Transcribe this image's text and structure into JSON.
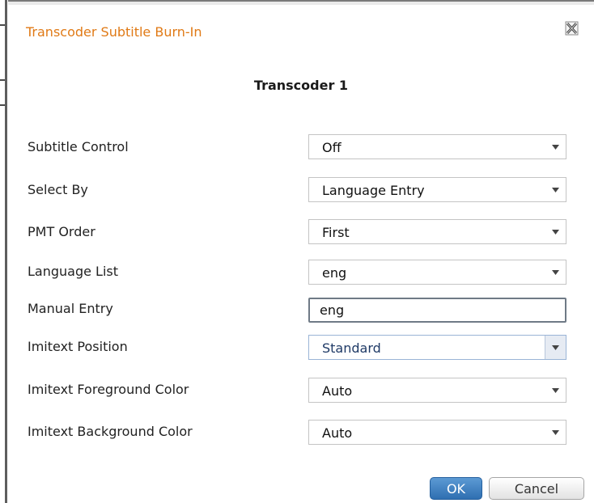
{
  "dialog": {
    "title": "Transcoder Subtitle Burn-In",
    "subheading": "Transcoder 1",
    "close_icon": "close-icon"
  },
  "fields": {
    "subtitle_control": {
      "label": "Subtitle Control",
      "value": "Off"
    },
    "select_by": {
      "label": "Select By",
      "value": "Language Entry"
    },
    "pmt_order": {
      "label": "PMT Order",
      "value": "First"
    },
    "language_list": {
      "label": "Language List",
      "value": "eng"
    },
    "manual_entry": {
      "label": "Manual Entry",
      "value": "eng"
    },
    "imitext_position": {
      "label": "Imitext Position",
      "value": "Standard"
    },
    "imitext_foreground_color": {
      "label": "Imitext Foreground Color",
      "value": "Auto"
    },
    "imitext_background_color": {
      "label": "Imitext Background Color",
      "value": "Auto"
    }
  },
  "buttons": {
    "ok_label": "OK",
    "cancel_label": "Cancel"
  },
  "colors": {
    "title": "#e07a16",
    "ok_button": "#2f6fb1"
  }
}
